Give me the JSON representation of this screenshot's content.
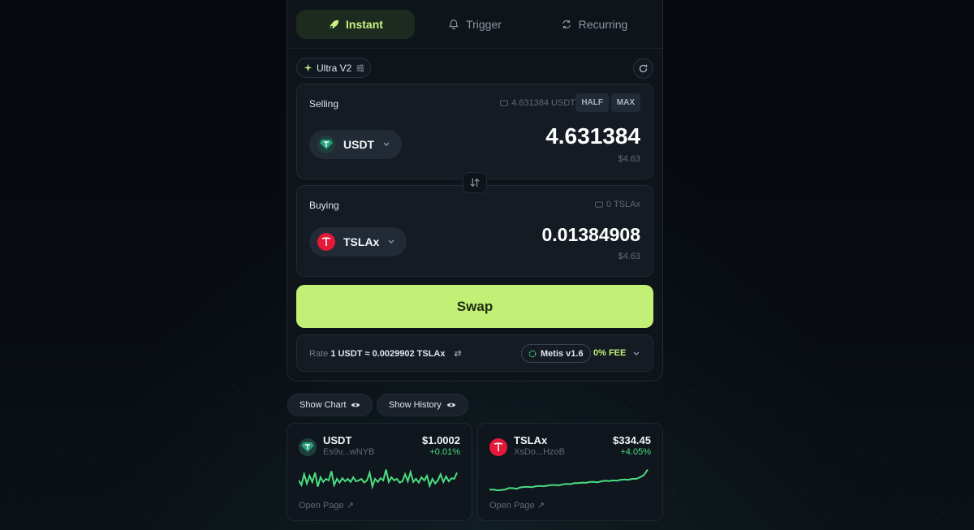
{
  "tabs": [
    {
      "label": "Instant",
      "icon": "rocket-icon",
      "active": true
    },
    {
      "label": "Trigger",
      "icon": "bell-icon",
      "active": false
    },
    {
      "label": "Recurring",
      "icon": "recurring-icon",
      "active": false
    }
  ],
  "mode_pill": {
    "label": "Ultra V2"
  },
  "selling": {
    "label": "Selling",
    "balance": "4.631384 USDT",
    "half_label": "HALF",
    "max_label": "MAX",
    "token": "USDT",
    "amount": "4.631384",
    "usd_value": "$4.63"
  },
  "buying": {
    "label": "Buying",
    "balance": "0 TSLAx",
    "token": "TSLAx",
    "amount": "0.01384908",
    "usd_value": "$4.63"
  },
  "swap_label": "Swap",
  "rate": {
    "prefix": "Rate",
    "value": "1 USDT ≈ 0.0029902 TSLAx",
    "router": "Metis v1.6",
    "fee": "0% FEE"
  },
  "buttons": {
    "show_chart": "Show Chart",
    "show_history": "Show History"
  },
  "cards": [
    {
      "symbol": "USDT",
      "address": "Es9v...wNYB",
      "price": "$1.0002",
      "change": "+0.01%",
      "open_label": "Open Page ↗",
      "spark": [
        0.55,
        0.7,
        0.35,
        0.65,
        0.4,
        0.6,
        0.3,
        0.75,
        0.45,
        0.6,
        0.5,
        0.55,
        0.25,
        0.7,
        0.5,
        0.62,
        0.48,
        0.58,
        0.5,
        0.6,
        0.45,
        0.58,
        0.55,
        0.5,
        0.62,
        0.55,
        0.3,
        0.75,
        0.5,
        0.6,
        0.48,
        0.55,
        0.2,
        0.6,
        0.45,
        0.55,
        0.5,
        0.62,
        0.58,
        0.35,
        0.58,
        0.28,
        0.6,
        0.5,
        0.62,
        0.45,
        0.55,
        0.4,
        0.72,
        0.5,
        0.65,
        0.55,
        0.35,
        0.6,
        0.42,
        0.58,
        0.48,
        0.5,
        0.3
      ]
    },
    {
      "symbol": "TSLAx",
      "address": "XsDo...HzoB",
      "price": "$334.45",
      "change": "+4.05%",
      "open_label": "Open Page ↗",
      "spark": [
        0.85,
        0.85,
        0.87,
        0.86,
        0.85,
        0.8,
        0.8,
        0.82,
        0.78,
        0.76,
        0.76,
        0.77,
        0.74,
        0.73,
        0.74,
        0.72,
        0.7,
        0.7,
        0.71,
        0.68,
        0.66,
        0.67,
        0.64,
        0.64,
        0.62,
        0.63,
        0.6,
        0.6,
        0.61,
        0.58,
        0.56,
        0.57,
        0.55,
        0.56,
        0.53,
        0.52,
        0.53,
        0.5,
        0.5,
        0.45,
        0.38,
        0.2
      ]
    }
  ],
  "colors": {
    "accent": "#c2ef75",
    "positive": "#4ade80",
    "usdt": "#26a17b",
    "tsla": "#e31937"
  }
}
